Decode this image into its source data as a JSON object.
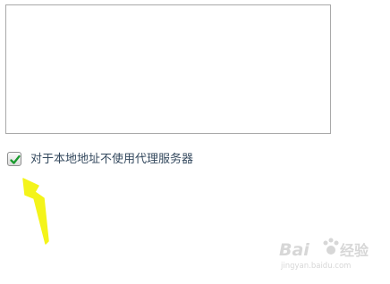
{
  "bypass_list": {
    "value": ""
  },
  "bypass_local": {
    "checked": true,
    "label": "对于本地地址不使用代理服务器"
  },
  "colors": {
    "checkmark": "#1a9b2e",
    "arrow": "#f4f41a"
  },
  "icons": {
    "checkbox": "check-icon",
    "annotation": "arrow-icon"
  }
}
